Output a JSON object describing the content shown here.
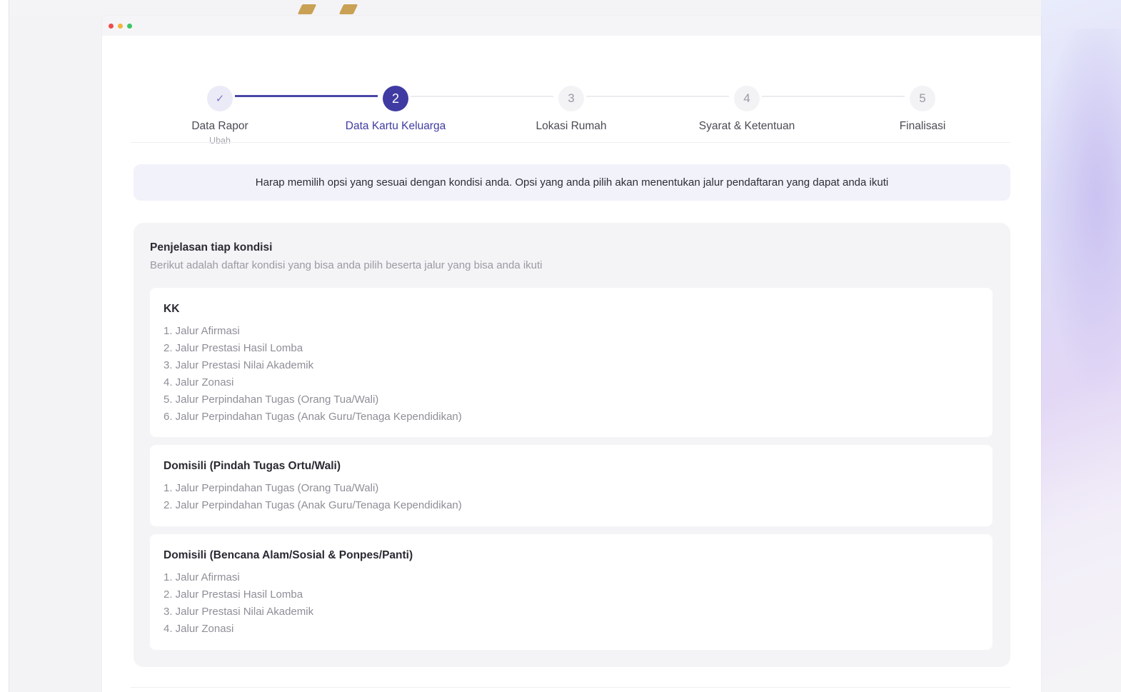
{
  "stepper": {
    "steps": [
      {
        "number": "✓",
        "label": "Data Rapor",
        "sub": "Ubah",
        "state": "done"
      },
      {
        "number": "2",
        "label": "Data Kartu Keluarga",
        "state": "active"
      },
      {
        "number": "3",
        "label": "Lokasi Rumah",
        "state": "pending"
      },
      {
        "number": "4",
        "label": "Syarat & Ketentuan",
        "state": "pending"
      },
      {
        "number": "5",
        "label": "Finalisasi",
        "state": "pending"
      }
    ]
  },
  "banner": {
    "text": "Harap memilih opsi yang sesuai dengan kondisi anda. Opsi yang anda pilih akan menentukan jalur pendaftaran yang dapat anda ikuti"
  },
  "explanation": {
    "title": "Penjelasan tiap kondisi",
    "subtitle": "Berikut adalah daftar kondisi yang bisa anda pilih beserta jalur yang bisa anda ikuti",
    "cards": [
      {
        "title": "KK",
        "items": [
          "1. Jalur Afirmasi",
          "2. Jalur Prestasi Hasil Lomba",
          "3. Jalur Prestasi Nilai Akademik",
          "4. Jalur Zonasi",
          "5. Jalur Perpindahan Tugas (Orang Tua/Wali)",
          "6. Jalur Perpindahan Tugas (Anak Guru/Tenaga Kependidikan)"
        ]
      },
      {
        "title": "Domisili (Pindah Tugas Ortu/Wali)",
        "items": [
          "1. Jalur Perpindahan Tugas (Orang Tua/Wali)",
          "2. Jalur Perpindahan Tugas (Anak Guru/Tenaga Kependidikan)"
        ]
      },
      {
        "title": "Domisili (Bencana Alam/Sosial & Ponpes/Panti)",
        "items": [
          "1. Jalur Afirmasi",
          "2. Jalur Prestasi Hasil Lomba",
          "3. Jalur Prestasi Nilai Akademik",
          "4. Jalur Zonasi"
        ]
      }
    ]
  },
  "colors": {
    "accent": "#3f3ba3",
    "banner_bg": "#f2f2fb",
    "panel_bg": "#f4f4f6"
  }
}
